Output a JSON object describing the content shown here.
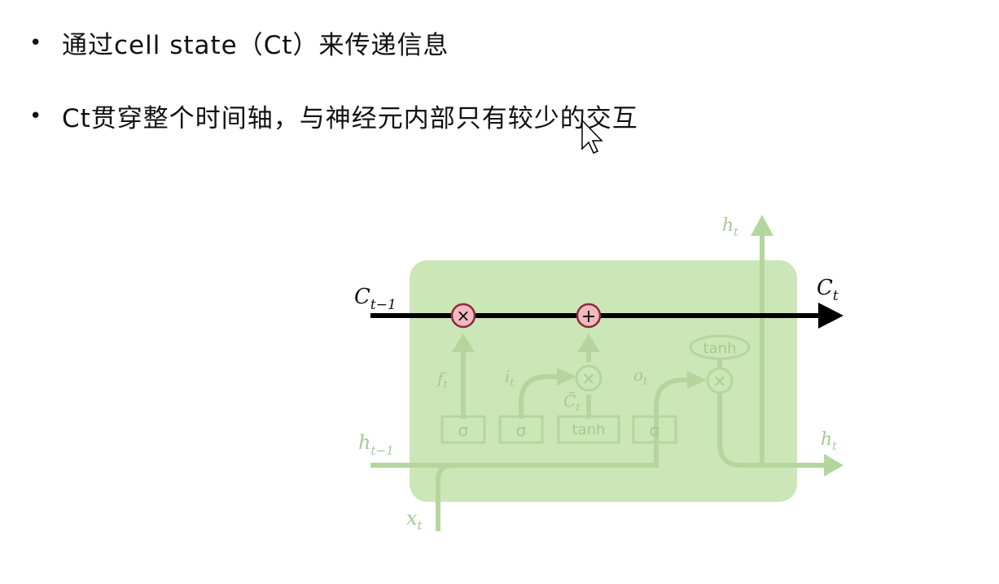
{
  "bullets": [
    {
      "symbol": "•",
      "text": "通过cell state（Ct）来传递信息"
    },
    {
      "symbol": "•",
      "text": "Ct贯穿整个时间轴，与神经元内部只有较少的交互"
    }
  ],
  "diagram": {
    "labels": {
      "c_prev": "C",
      "c_prev_sub": "t−1",
      "c_next": "C",
      "c_next_sub": "t",
      "h_prev": "h",
      "h_prev_sub": "t−1",
      "h_out_top": "h",
      "h_out_top_sub": "t",
      "h_out_right": "h",
      "h_out_right_sub": "t",
      "x_in": "x",
      "x_in_sub": "t",
      "f_gate": "f",
      "f_gate_sub": "t",
      "i_gate": "i",
      "i_gate_sub": "t",
      "c_tilde": "C̃",
      "c_tilde_sub": "t",
      "o_gate": "o",
      "o_gate_sub": "t"
    },
    "ops": {
      "mult": "×",
      "add": "+"
    },
    "layers": {
      "sigma1": "σ",
      "sigma2": "σ",
      "tanh": "tanh",
      "sigma3": "σ",
      "tanh_out": "tanh"
    },
    "colors": {
      "cell_bg": "#cbe6b7",
      "faded_line": "#b5d59f",
      "faded_text": "#a8c892",
      "cell_state_line": "#000000",
      "op_fill": "#f2b8c0",
      "op_stroke": "#8a2a37"
    }
  }
}
